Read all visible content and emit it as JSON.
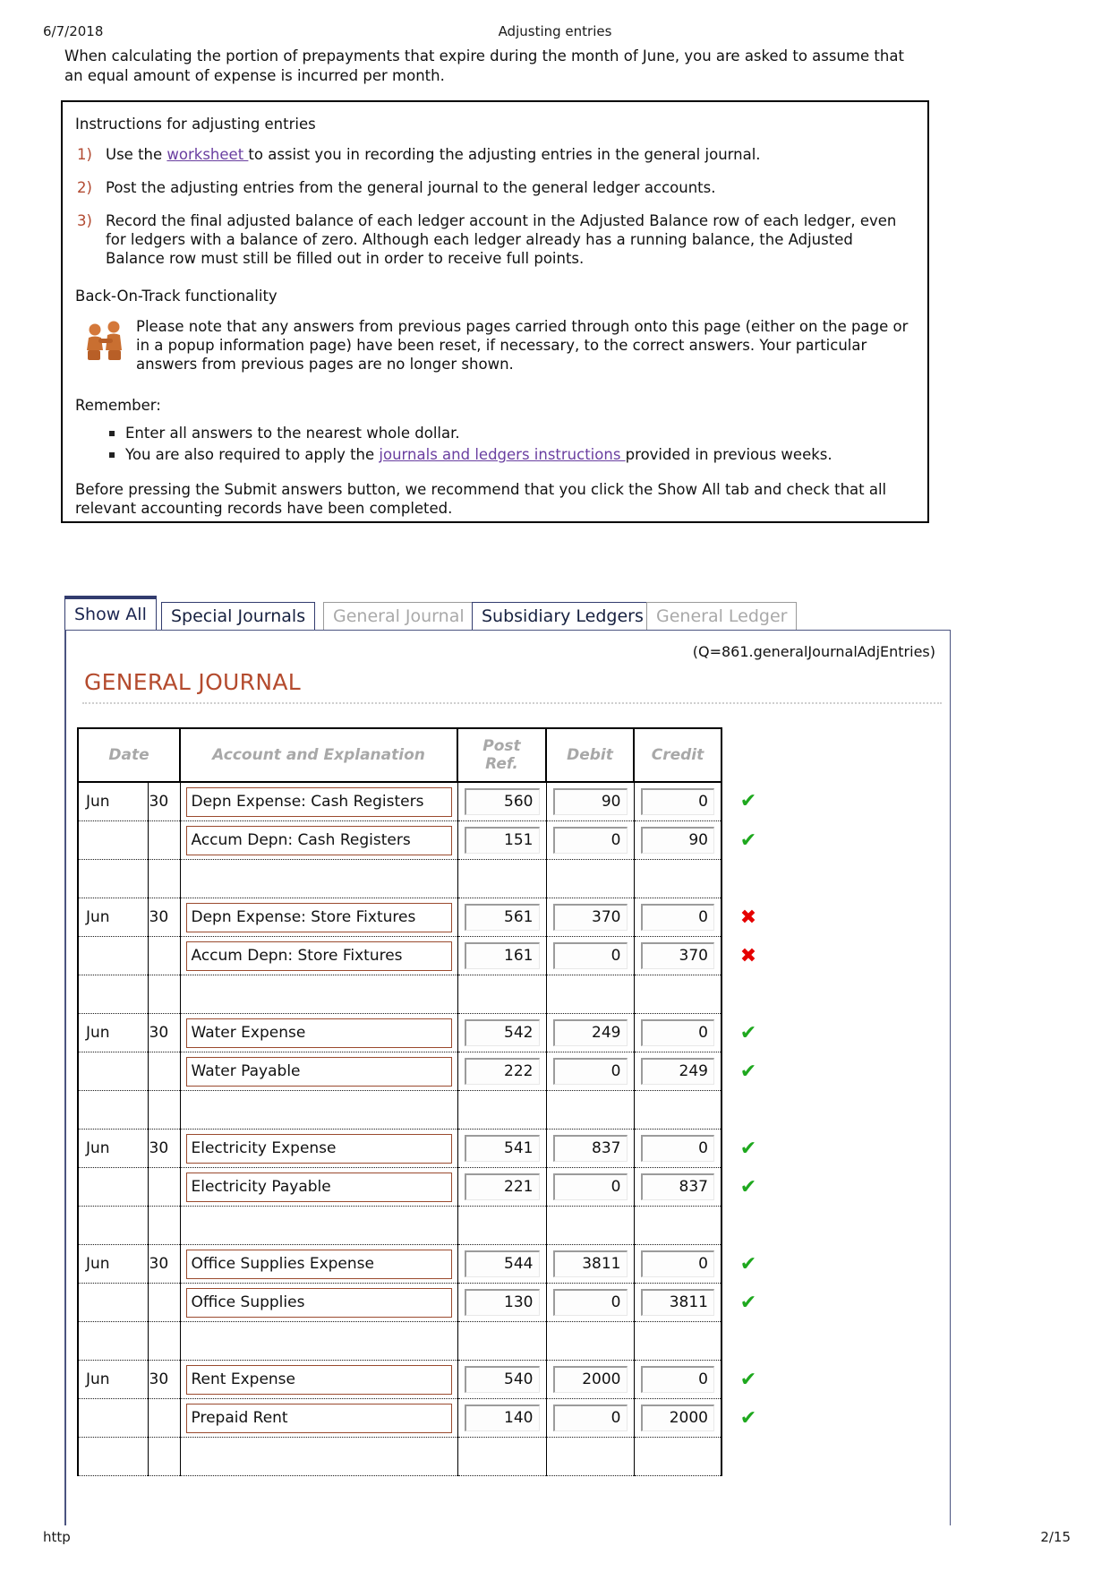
{
  "print_header": {
    "date": "6/7/2018",
    "title": "Adjusting entries"
  },
  "intro_paragraph": "When calculating the portion of prepayments that expire during the month of June, you are asked to assume that an equal amount of expense is incurred per month.",
  "instructions": {
    "heading": "Instructions for adjusting entries",
    "items": [
      {
        "num": "1)",
        "pre": "Use the ",
        "link": "worksheet ",
        "post": "to assist you in recording the adjusting entries in the general journal."
      },
      {
        "num": "2)",
        "pre": "Post the adjusting entries from the general journal to the general ledger accounts.",
        "link": "",
        "post": ""
      },
      {
        "num": "3)",
        "pre": "Record the final adjusted balance of each ledger account in the Adjusted Balance row of each ledger, even for ledgers with a balance of zero. Although each ledger already has a running balance, the Adjusted Balance row must still be filled out in order to receive full points.",
        "link": "",
        "post": ""
      }
    ],
    "back_on_track_heading": "Back-On-Track functionality",
    "back_on_track_text": "Please note that any answers from previous pages carried through onto this page (either on the page or in a popup information page) have been reset, if necessary, to the correct answers. Your particular answers from previous pages are no longer shown.",
    "back_on_track_icon": "two-people-helping-icon",
    "remember_label": "Remember:",
    "bullets": [
      {
        "pre": "Enter all answers to the nearest whole dollar.",
        "link": "",
        "post": ""
      },
      {
        "pre": "You are also required to apply the ",
        "link": "journals and ledgers instructions ",
        "post": "provided in previous weeks."
      }
    ],
    "closing": "Before pressing the Submit answers button, we recommend that you click the Show All tab and check that all relevant accounting records have been completed."
  },
  "tabs": [
    {
      "label": "Show All",
      "state": "active"
    },
    {
      "label": "Special Journals",
      "state": "on"
    },
    {
      "label": "General Journal",
      "state": "off"
    },
    {
      "label": "Subsidiary Ledgers",
      "state": "on"
    },
    {
      "label": "General Ledger",
      "state": "off"
    }
  ],
  "panel": {
    "question_tag": "(Q=861.generalJournalAdjEntries)",
    "section_title": "GENERAL JOURNAL"
  },
  "table": {
    "columns": [
      "Date",
      "Account and Explanation",
      "Post Ref.",
      "Debit",
      "Credit"
    ],
    "header_post_ref_line1": "Post",
    "header_post_ref_line2": "Ref.",
    "rows": [
      {
        "month": "Jun",
        "day": "30",
        "account": "Depn Expense: Cash Registers",
        "ref": "560",
        "debit": "90",
        "credit": "0",
        "mark": "check"
      },
      {
        "month": "",
        "day": "",
        "account": "Accum Depn: Cash Registers",
        "ref": "151",
        "debit": "0",
        "credit": "90",
        "mark": "check"
      },
      {
        "month": "",
        "day": "",
        "account": "",
        "ref": "",
        "debit": "",
        "credit": "",
        "mark": ""
      },
      {
        "month": "Jun",
        "day": "30",
        "account": "Depn Expense: Store Fixtures",
        "ref": "561",
        "debit": "370",
        "credit": "0",
        "mark": "cross"
      },
      {
        "month": "",
        "day": "",
        "account": "Accum Depn: Store Fixtures",
        "ref": "161",
        "debit": "0",
        "credit": "370",
        "mark": "cross"
      },
      {
        "month": "",
        "day": "",
        "account": "",
        "ref": "",
        "debit": "",
        "credit": "",
        "mark": ""
      },
      {
        "month": "Jun",
        "day": "30",
        "account": "Water Expense",
        "ref": "542",
        "debit": "249",
        "credit": "0",
        "mark": "check"
      },
      {
        "month": "",
        "day": "",
        "account": "Water Payable",
        "ref": "222",
        "debit": "0",
        "credit": "249",
        "mark": "check"
      },
      {
        "month": "",
        "day": "",
        "account": "",
        "ref": "",
        "debit": "",
        "credit": "",
        "mark": ""
      },
      {
        "month": "Jun",
        "day": "30",
        "account": "Electricity Expense",
        "ref": "541",
        "debit": "837",
        "credit": "0",
        "mark": "check"
      },
      {
        "month": "",
        "day": "",
        "account": "Electricity Payable",
        "ref": "221",
        "debit": "0",
        "credit": "837",
        "mark": "check"
      },
      {
        "month": "",
        "day": "",
        "account": "",
        "ref": "",
        "debit": "",
        "credit": "",
        "mark": ""
      },
      {
        "month": "Jun",
        "day": "30",
        "account": "Office Supplies Expense",
        "ref": "544",
        "debit": "3811",
        "credit": "0",
        "mark": "check"
      },
      {
        "month": "",
        "day": "",
        "account": "Office Supplies",
        "ref": "130",
        "debit": "0",
        "credit": "3811",
        "mark": "check"
      },
      {
        "month": "",
        "day": "",
        "account": "",
        "ref": "",
        "debit": "",
        "credit": "",
        "mark": ""
      },
      {
        "month": "Jun",
        "day": "30",
        "account": "Rent Expense",
        "ref": "540",
        "debit": "2000",
        "credit": "0",
        "mark": "check"
      },
      {
        "month": "",
        "day": "",
        "account": "Prepaid Rent",
        "ref": "140",
        "debit": "0",
        "credit": "2000",
        "mark": "check"
      },
      {
        "month": "",
        "day": "",
        "account": "",
        "ref": "",
        "debit": "",
        "credit": "",
        "mark": ""
      }
    ],
    "mark_glyphs": {
      "check": "✔",
      "cross": "✖"
    }
  },
  "footer": {
    "left": "http",
    "right": "2/15"
  },
  "colors": {
    "accent_red": "#b44b2e",
    "list_number": "#b24a31",
    "link": "#6a3fa0",
    "tab_navy": "#323c6e",
    "tab_disabled": "#a9a9a9",
    "header_grey": "#a8a8a8",
    "field_border": "#9a4a2e",
    "check_green": "#1ea81e",
    "cross_red": "#e50000"
  }
}
